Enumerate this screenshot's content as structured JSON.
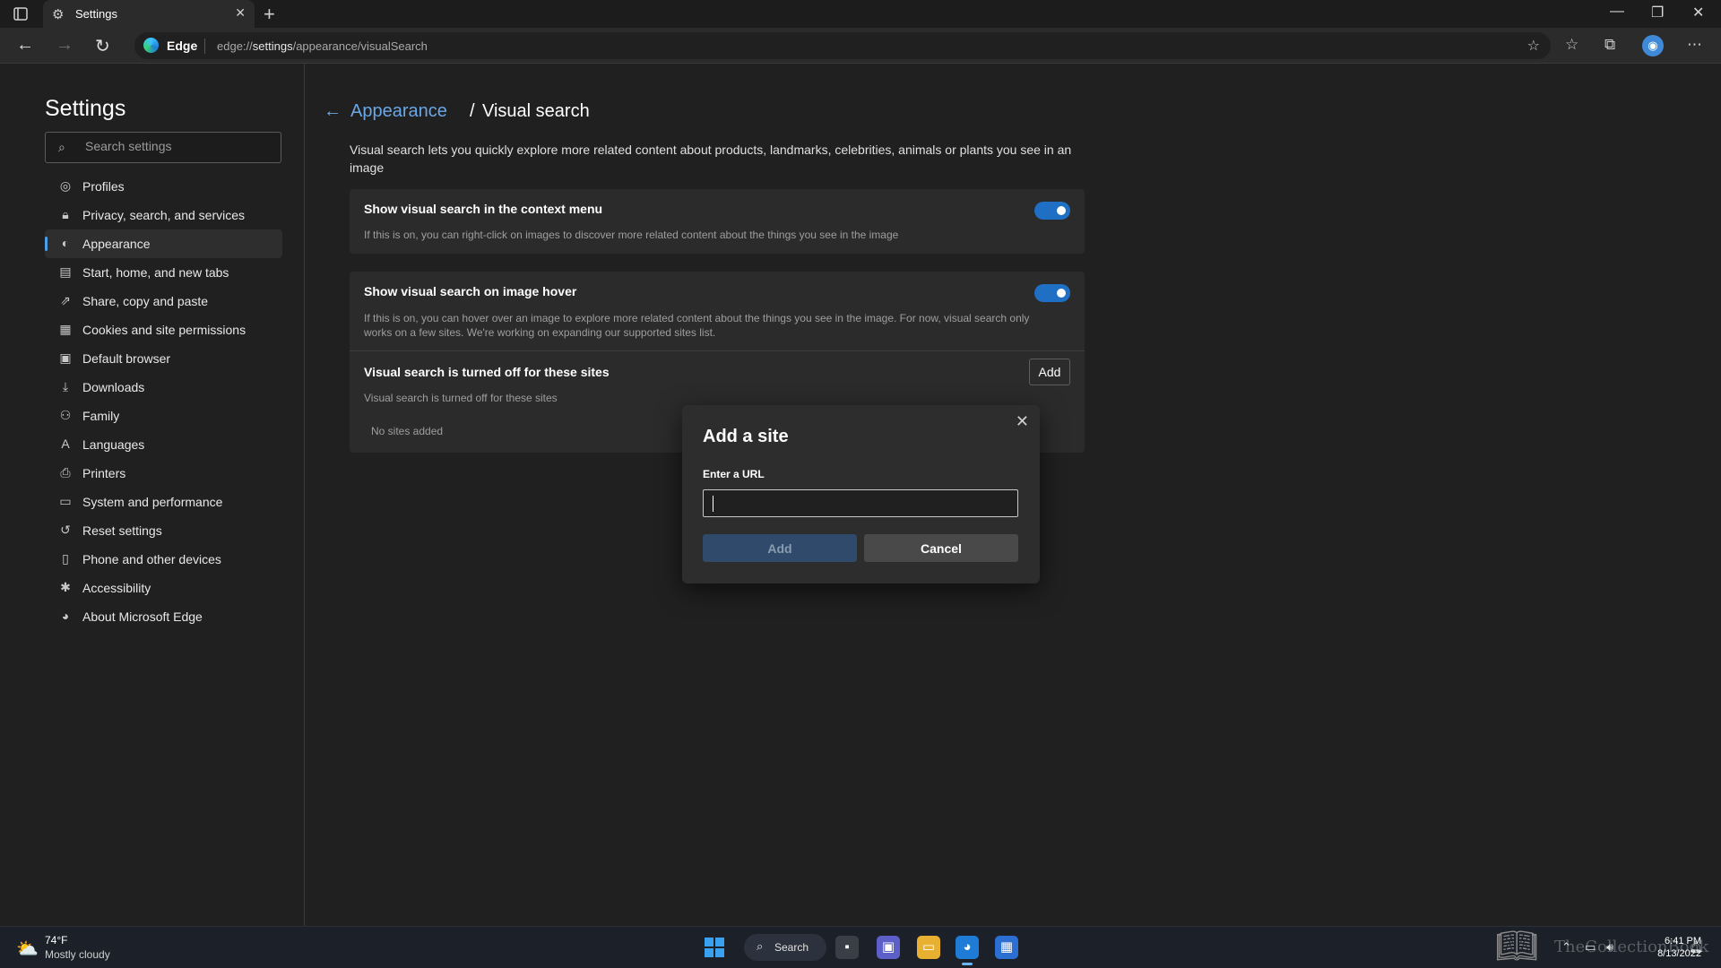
{
  "browser": {
    "tab_title": "Settings",
    "address_brand": "Edge",
    "url_prefix": "edge://",
    "url_host": "settings",
    "url_path": "/appearance/visualSearch"
  },
  "sidebar": {
    "title": "Settings",
    "search_placeholder": "Search settings",
    "items": [
      {
        "label": "Profiles",
        "icon": "profile-icon"
      },
      {
        "label": "Privacy, search, and services",
        "icon": "lock-icon"
      },
      {
        "label": "Appearance",
        "icon": "appearance-icon",
        "active": true
      },
      {
        "label": "Start, home, and new tabs",
        "icon": "home-tabs-icon"
      },
      {
        "label": "Share, copy and paste",
        "icon": "share-icon"
      },
      {
        "label": "Cookies and site permissions",
        "icon": "cookies-icon"
      },
      {
        "label": "Default browser",
        "icon": "browser-icon"
      },
      {
        "label": "Downloads",
        "icon": "download-icon"
      },
      {
        "label": "Family",
        "icon": "family-icon"
      },
      {
        "label": "Languages",
        "icon": "languages-icon"
      },
      {
        "label": "Printers",
        "icon": "printer-icon"
      },
      {
        "label": "System and performance",
        "icon": "system-icon"
      },
      {
        "label": "Reset settings",
        "icon": "reset-icon"
      },
      {
        "label": "Phone and other devices",
        "icon": "phone-icon"
      },
      {
        "label": "Accessibility",
        "icon": "accessibility-icon"
      },
      {
        "label": "About Microsoft Edge",
        "icon": "edge-icon"
      }
    ]
  },
  "main": {
    "breadcrumb_parent": "Appearance",
    "breadcrumb_separator": "/",
    "breadcrumb_current": "Visual search",
    "description": "Visual search lets you quickly explore more related content about products, landmarks, celebrities, animals or plants you see in an image",
    "context_menu": {
      "title": "Show visual search in the context menu",
      "subtitle": "If this is on, you can right-click on images to discover more related content about the things you see in the image",
      "enabled": true
    },
    "image_hover": {
      "title": "Show visual search on image hover",
      "subtitle": "If this is on, you can hover over an image to explore more related content about the things you see in the image. For now, visual search only works on a few sites. We're working on expanding our supported sites list.",
      "enabled": true
    },
    "blocked_sites": {
      "title": "Visual search is turned off for these sites",
      "subtitle": "Visual search is turned off for these sites",
      "add_label": "Add",
      "empty_text": "No sites added"
    }
  },
  "dialog": {
    "title": "Add a site",
    "field_label": "Enter a URL",
    "field_value": "",
    "add_label": "Add",
    "cancel_label": "Cancel"
  },
  "taskbar": {
    "temperature": "74°F",
    "condition": "Mostly cloudy",
    "search_label": "Search",
    "time": "6:41 PM",
    "date": "8/13/2022",
    "watermark": "TheCollectionBook"
  },
  "colors": {
    "accent": "#1f6fc5",
    "link": "#6aa7e6",
    "background": "#202020",
    "card": "#2b2b2b"
  }
}
